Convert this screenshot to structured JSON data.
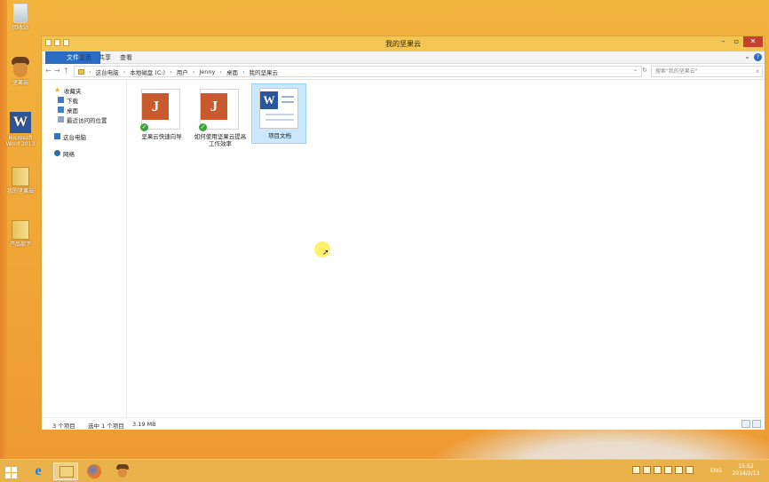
{
  "desktop": {
    "icons": [
      {
        "name": "recycle-bin",
        "label": "回收站"
      },
      {
        "name": "jianguoyun",
        "label": "坚果云"
      },
      {
        "name": "word-2013",
        "label": "Microsoft Word 2013"
      },
      {
        "name": "my-jianguoyun",
        "label": "我的坚果云"
      },
      {
        "name": "downloads",
        "label": "产品部下"
      }
    ]
  },
  "window": {
    "title": "我的坚果云",
    "ribbon_tabs": [
      "文件",
      "主页",
      "共享",
      "查看"
    ],
    "help_icon": "?",
    "address": {
      "segments": [
        "这台电脑",
        "本地磁盘 (C:)",
        "用户",
        "Jenny",
        "桌面",
        "我的坚果云"
      ],
      "search_placeholder": "搜索\"我的坚果云\""
    },
    "nav": {
      "favorites": [
        "收藏夹",
        "下载",
        "桌面",
        "最近访问的位置"
      ],
      "this_pc": "这台电脑",
      "network": "网络"
    },
    "files": [
      {
        "name": "坚果云快速向导",
        "type": "pdf",
        "synced": true
      },
      {
        "name": "如何使用坚果云提高工作效率",
        "type": "pdf",
        "synced": true
      },
      {
        "name": "项目文档",
        "type": "word",
        "synced": false,
        "selected": true
      }
    ],
    "status": {
      "item_count": "3 个项目",
      "selection": "选中 1 个项目",
      "size": "3.19 MB"
    }
  },
  "taskbar": {
    "lang": "ENG",
    "time": "15:52",
    "date": "2014/2/13"
  },
  "colors": {
    "desktop": "#f0a838",
    "window_frame": "#f3c552",
    "file_tab": "#2a6cc4",
    "close_button": "#c7402e",
    "selection": "#cce8ff"
  }
}
